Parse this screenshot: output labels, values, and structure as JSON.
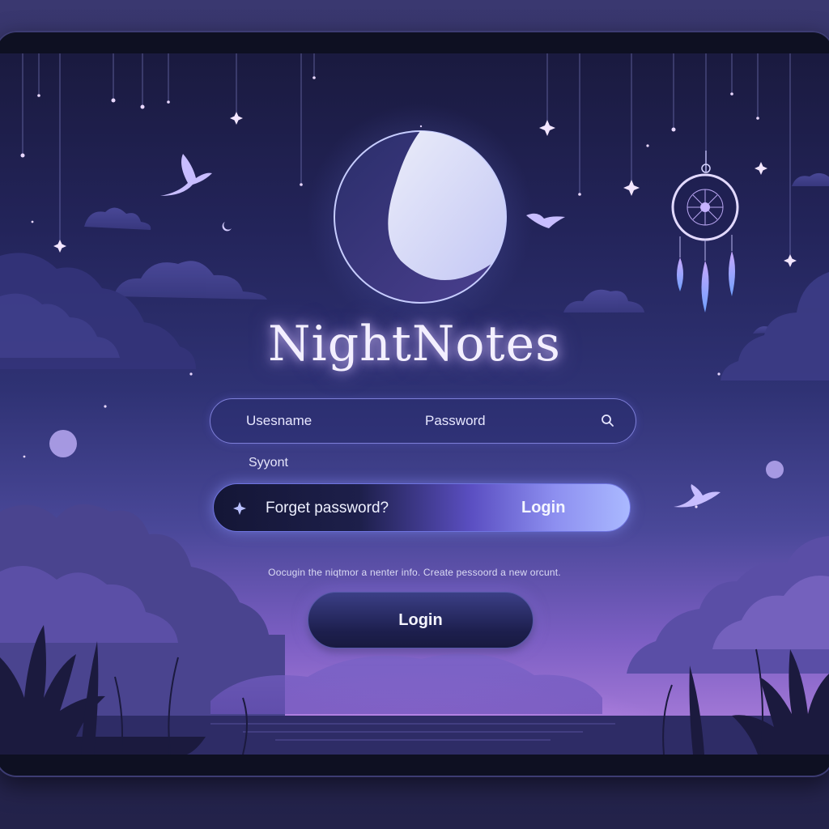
{
  "app": {
    "title": "NightNotes"
  },
  "login_form": {
    "username_label": "Usesname",
    "password_label": "Password",
    "helper_text": "Syyont",
    "forgot_password_label": "Forget password?",
    "inline_login_label": "Login",
    "footnote": "Oocugin the niqtmor a nenter info. Create pessoord a new orcunt.",
    "login_button_label": "Login"
  },
  "icons": {
    "search": "search-icon",
    "sparkle": "sparkle-icon",
    "moon": "crescent-moon-icon",
    "dreamcatcher": "dreamcatcher-icon",
    "bird": "bird-icon",
    "star": "star-icon"
  },
  "colors": {
    "accent": "#8d8ff0",
    "title_glow": "#dcc8ff",
    "background_dark": "#1a1a3f",
    "horizon_glow": "#f0c8ff"
  }
}
